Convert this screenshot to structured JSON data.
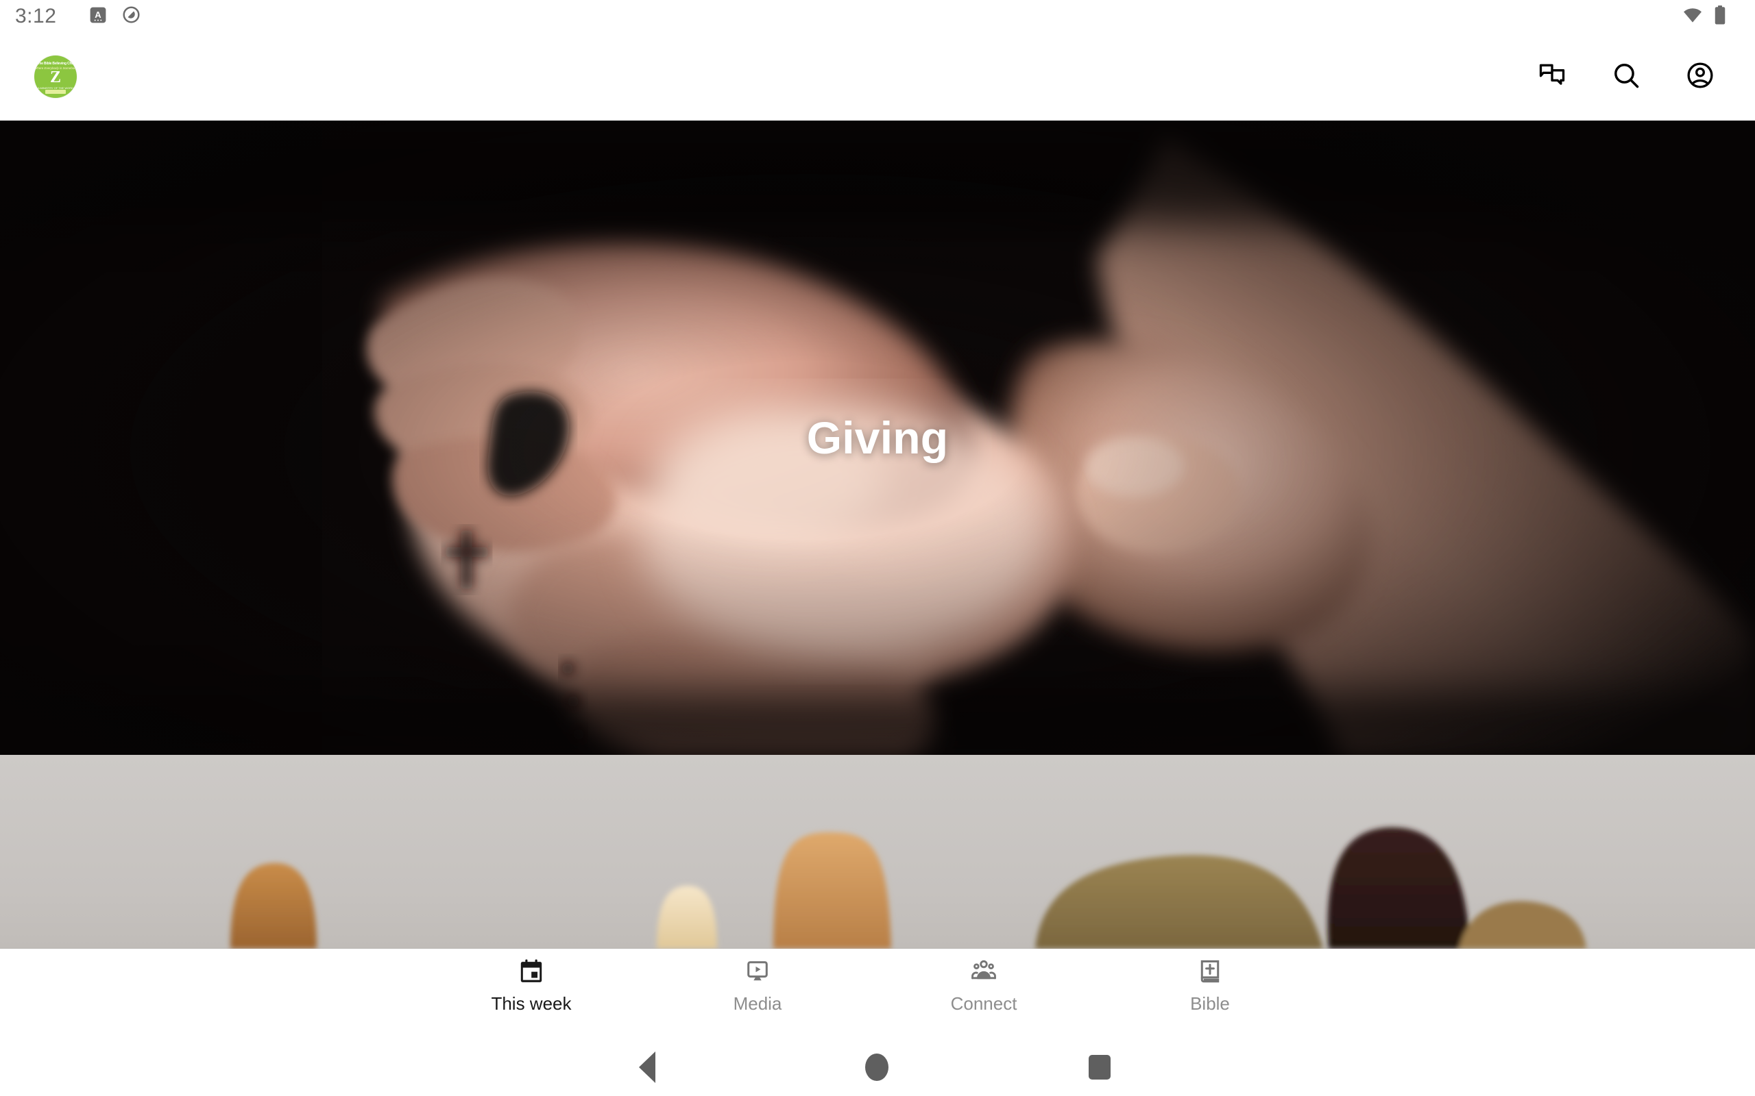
{
  "status_bar": {
    "clock": "3:12",
    "icons": [
      {
        "name": "accessibility-font-icon",
        "glyph": "A"
      },
      {
        "name": "do-not-disturb-icon",
        "glyph": "⊘"
      }
    ],
    "right_icons": [
      {
        "name": "wifi-icon"
      },
      {
        "name": "battery-full-icon"
      }
    ]
  },
  "header": {
    "logo": {
      "name": "church-logo",
      "top_text": "Some Bible Believing Church",
      "sub_text": "Where Everybody is Somebody",
      "mark": "Z",
      "bottom_text": "A MINISTRY OF THE WORD",
      "background_color": "#8cc640"
    },
    "actions": [
      {
        "name": "messages-icon",
        "label": "Messages"
      },
      {
        "name": "search-icon",
        "label": "Search"
      },
      {
        "name": "account-icon",
        "label": "Account"
      }
    ]
  },
  "hero": {
    "title": "Giving",
    "image_alt": "Open cupped hands in dark light",
    "background_color": "#120d0d"
  },
  "second_card": {
    "image_alt": "Tops of heads of a crowd against a pale sky",
    "background_color": "#c7c4c1"
  },
  "bottom_nav": {
    "tabs": [
      {
        "label": "This week",
        "icon": "calendar-icon",
        "active": true
      },
      {
        "label": "Media",
        "icon": "tv-play-icon",
        "active": false
      },
      {
        "label": "Connect",
        "icon": "people-group-icon",
        "active": false
      },
      {
        "label": "Bible",
        "icon": "bible-book-icon",
        "active": false
      }
    ],
    "active_color": "#191919",
    "inactive_color": "#8d8d8d"
  },
  "system_nav": {
    "buttons": [
      {
        "name": "android-back-button",
        "label": "Back"
      },
      {
        "name": "android-home-button",
        "label": "Home"
      },
      {
        "name": "android-recents-button",
        "label": "Recents"
      }
    ],
    "color": "#5f5f5f"
  }
}
